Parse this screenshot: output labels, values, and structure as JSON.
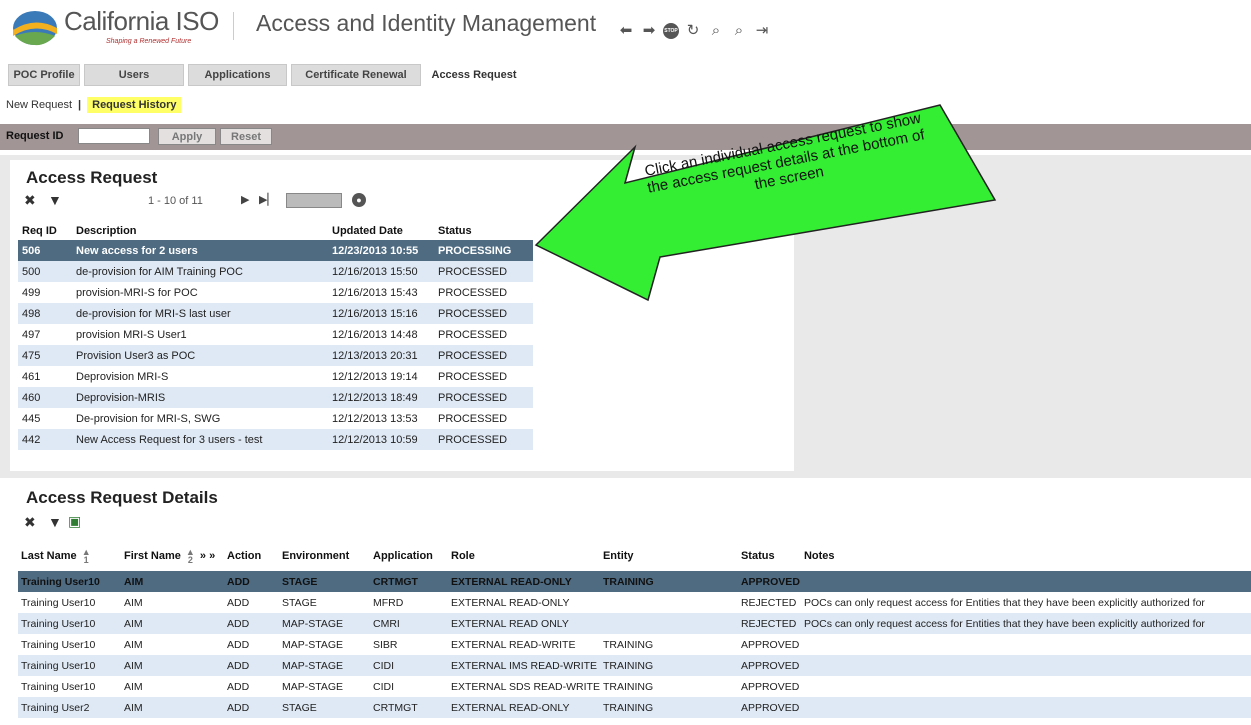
{
  "header": {
    "logo_text": "California ISO",
    "logo_tagline": "Shaping a Renewed Future",
    "title": "Access and Identity Management",
    "nav_icons": [
      "back-arrow-icon",
      "forward-arrow-icon",
      "stop-icon",
      "refresh-icon",
      "zoom-out-icon",
      "zoom-in-icon",
      "logout-icon"
    ],
    "stop_label": "STOP"
  },
  "tabs": [
    {
      "label": "POC Profile",
      "active": false
    },
    {
      "label": "Users",
      "active": false
    },
    {
      "label": "Applications",
      "active": false
    },
    {
      "label": "Certificate Renewal",
      "active": false
    },
    {
      "label": "Access Request",
      "active": true
    }
  ],
  "subnav": {
    "new_request": "New Request",
    "separator": "|",
    "request_history": "Request History"
  },
  "filter": {
    "label": "Request ID",
    "value": "",
    "apply": "Apply",
    "reset": "Reset"
  },
  "access_request": {
    "title": "Access Request",
    "pager": "1  -  10  of  11",
    "columns": [
      "Req ID",
      "Description",
      "Updated Date",
      "Status"
    ],
    "rows": [
      {
        "id": "506",
        "desc": "New access for 2 users",
        "date": "12/23/2013 10:55",
        "status": "PROCESSING",
        "selected": true
      },
      {
        "id": "500",
        "desc": "de-provision for AIM Training POC",
        "date": "12/16/2013 15:50",
        "status": "PROCESSED"
      },
      {
        "id": "499",
        "desc": "provision-MRI-S for POC",
        "date": "12/16/2013 15:43",
        "status": "PROCESSED"
      },
      {
        "id": "498",
        "desc": "de-provision for MRI-S last user",
        "date": "12/16/2013 15:16",
        "status": "PROCESSED"
      },
      {
        "id": "497",
        "desc": "provision MRI-S User1",
        "date": "12/16/2013 14:48",
        "status": "PROCESSED"
      },
      {
        "id": "475",
        "desc": "Provision User3 as POC",
        "date": "12/13/2013 20:31",
        "status": "PROCESSED"
      },
      {
        "id": "461",
        "desc": "Deprovision MRI-S",
        "date": "12/12/2013 19:14",
        "status": "PROCESSED"
      },
      {
        "id": "460",
        "desc": "Deprovision-MRIS",
        "date": "12/12/2013 18:49",
        "status": "PROCESSED"
      },
      {
        "id": "445",
        "desc": "De-provision for MRI-S, SWG",
        "date": "12/12/2013 13:53",
        "status": "PROCESSED"
      },
      {
        "id": "442",
        "desc": "New Access Request for 3 users - test",
        "date": "12/12/2013 10:59",
        "status": "PROCESSED"
      }
    ]
  },
  "callout": {
    "text": "Click an individual access request to show the access request details at the bottom of the screen",
    "color": "#33ee33"
  },
  "details": {
    "title": "Access Request Details",
    "columns": {
      "last_name": "Last Name",
      "first_name": "First Name",
      "sort1": "1",
      "sort2": "2",
      "skip": "»  »",
      "action": "Action",
      "environment": "Environment",
      "application": "Application",
      "role": "Role",
      "entity": "Entity",
      "status": "Status",
      "notes": "Notes"
    },
    "rows": [
      {
        "last": "Training User10",
        "first": "AIM",
        "action": "ADD",
        "env": "STAGE",
        "app": "CRTMGT",
        "role": "EXTERNAL READ-ONLY",
        "entity": "TRAINING",
        "status": "APPROVED",
        "notes": "",
        "selected": true
      },
      {
        "last": "Training User10",
        "first": "AIM",
        "action": "ADD",
        "env": "STAGE",
        "app": "MFRD",
        "role": "EXTERNAL READ-ONLY",
        "entity": "",
        "status": "REJECTED",
        "notes": "POCs can only request access for Entities that they have been explicitly authorized for"
      },
      {
        "last": "Training User10",
        "first": "AIM",
        "action": "ADD",
        "env": "MAP-STAGE",
        "app": "CMRI",
        "role": "EXTERNAL READ ONLY",
        "entity": "",
        "status": "REJECTED",
        "notes": "POCs can only request access for Entities that they have been explicitly authorized for"
      },
      {
        "last": "Training User10",
        "first": "AIM",
        "action": "ADD",
        "env": "MAP-STAGE",
        "app": "SIBR",
        "role": "EXTERNAL READ-WRITE",
        "entity": "TRAINING",
        "status": "APPROVED",
        "notes": ""
      },
      {
        "last": "Training User10",
        "first": "AIM",
        "action": "ADD",
        "env": "MAP-STAGE",
        "app": "CIDI",
        "role": "EXTERNAL IMS READ-WRITE",
        "entity": "TRAINING",
        "status": "APPROVED",
        "notes": ""
      },
      {
        "last": "Training User10",
        "first": "AIM",
        "action": "ADD",
        "env": "MAP-STAGE",
        "app": "CIDI",
        "role": "EXTERNAL SDS READ-WRITE",
        "entity": "TRAINING",
        "status": "APPROVED",
        "notes": ""
      },
      {
        "last": "Training User2",
        "first": "AIM",
        "action": "ADD",
        "env": "STAGE",
        "app": "CRTMGT",
        "role": "EXTERNAL READ-ONLY",
        "entity": "TRAINING",
        "status": "APPROVED",
        "notes": ""
      }
    ]
  }
}
